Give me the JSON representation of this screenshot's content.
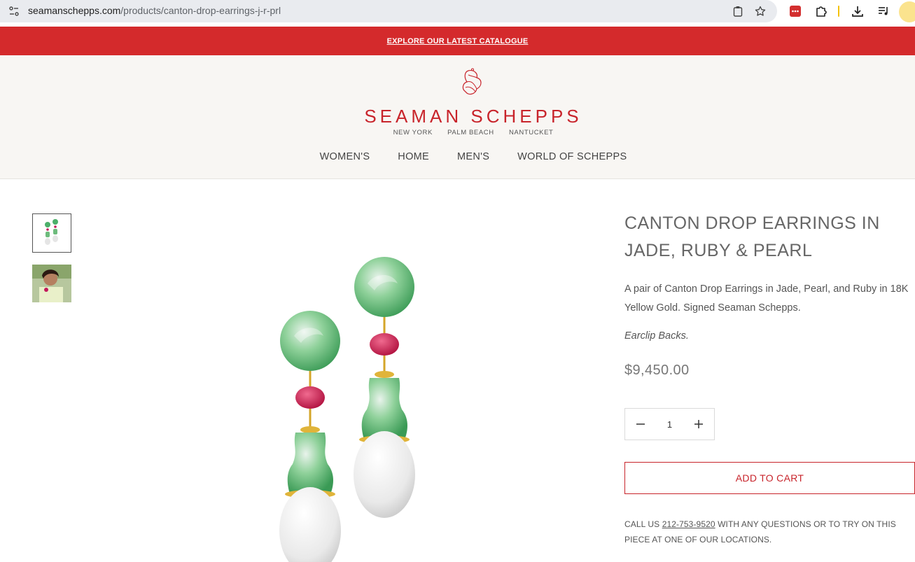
{
  "browser": {
    "url_domain": "seamanschepps.com",
    "url_path": "/products/canton-drop-earrings-j-r-prl"
  },
  "promo": {
    "link_label": "EXPLORE OUR LATEST CATALOGUE"
  },
  "header": {
    "brand": "SEAMAN SCHEPPS",
    "locations": [
      "NEW YORK",
      "PALM BEACH",
      "NANTUCKET"
    ],
    "nav": [
      "WOMEN'S",
      "HOME",
      "MEN'S",
      "WORLD OF SCHEPPS"
    ]
  },
  "product": {
    "title_line1": "CANTON DROP EARRINGS IN",
    "title_line2": "JADE, RUBY & PEARL",
    "description": "A pair of Canton Drop Earrings in Jade, Pearl, and Ruby in 18K Yellow Gold. Signed Seaman Schepps.",
    "note": "Earclip Backs.",
    "price": "$9,450.00",
    "quantity": "1",
    "add_to_cart": "ADD TO CART",
    "call_prefix": "CALL US ",
    "phone": "212-753-9520",
    "call_suffix": "  WITH ANY QUESTIONS OR TO TRY ON THIS PIECE AT ONE OF OUR LOCATIONS."
  },
  "colors": {
    "brand_red": "#c8242b",
    "promo_red": "#d42a2c",
    "header_bg": "#f8f6f3"
  },
  "icons": [
    "site-info-icon",
    "clipboard-icon",
    "star-icon",
    "extension-red-icon",
    "puzzle-icon",
    "download-icon",
    "media-queue-icon"
  ]
}
